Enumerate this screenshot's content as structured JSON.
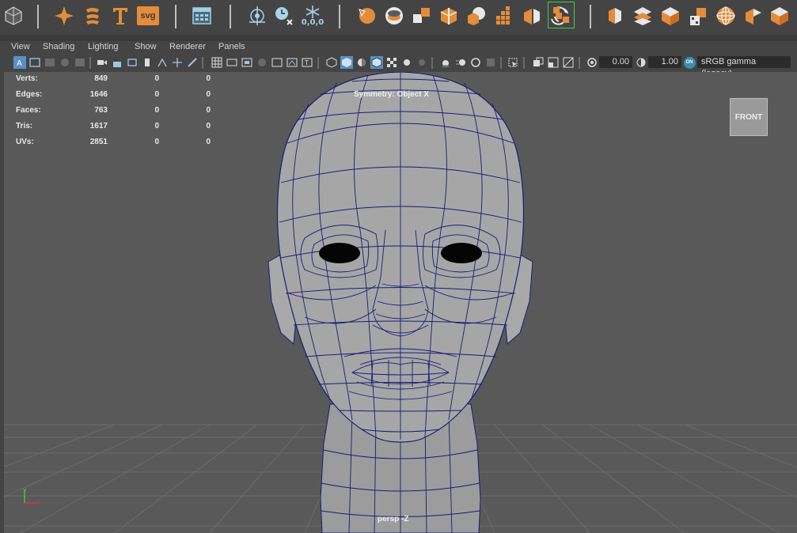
{
  "shelf": {
    "icons": [
      "polygon-sphere-icon",
      "sparkle-icon",
      "sweep-text-icon",
      "text-icon",
      "svg-icon",
      "graph-editor-icon",
      "center-pivot-icon",
      "freeze-transform-icon",
      "snowflake-reset-icon",
      "sphere-select-icon",
      "cylinder-cap-icon",
      "cube-split-icon",
      "cube-merge-icon",
      "boolean-icon",
      "grid-cube-icon",
      "cube-cut-icon",
      "cube-cycle-icon",
      "cube-swap-icon",
      "box-extrude-icon",
      "layers-icon",
      "cube-open-icon",
      "cube-pattern-icon",
      "sphere-grid-icon",
      "cube-slice-icon",
      "cube-corner-icon"
    ],
    "svg_label": "svg",
    "freeze_label": "0,0,0"
  },
  "menu": {
    "items": [
      "View",
      "Shading",
      "Lighting",
      "Show",
      "Renderer",
      "Panels"
    ]
  },
  "toolbar": {
    "exposure_value": "0.00",
    "gamma_value": "1.00",
    "color_space": "sRGB gamma (legacy)",
    "on_badge": "ON"
  },
  "hud": {
    "rows": [
      {
        "label": "Verts:",
        "values": [
          "849",
          "0",
          "0"
        ]
      },
      {
        "label": "Edges:",
        "values": [
          "1646",
          "0",
          "0"
        ]
      },
      {
        "label": "Faces:",
        "values": [
          "763",
          "0",
          "0"
        ]
      },
      {
        "label": "Tris:",
        "values": [
          "1617",
          "0",
          "0"
        ]
      },
      {
        "label": "UVs:",
        "values": [
          "2851",
          "0",
          "0"
        ]
      }
    ],
    "symmetry": "Symmetry: Object X",
    "camera": "persp -Z"
  },
  "viewcube": {
    "label": "FRONT"
  },
  "axis": {
    "y": "y",
    "x": "x"
  },
  "colors": {
    "accent": "#e48c3a",
    "wire": "#1b1b7a",
    "grid": "#6a6a6a",
    "viewport_bg": "#595959",
    "highlight_frame": "#3fce4a"
  }
}
